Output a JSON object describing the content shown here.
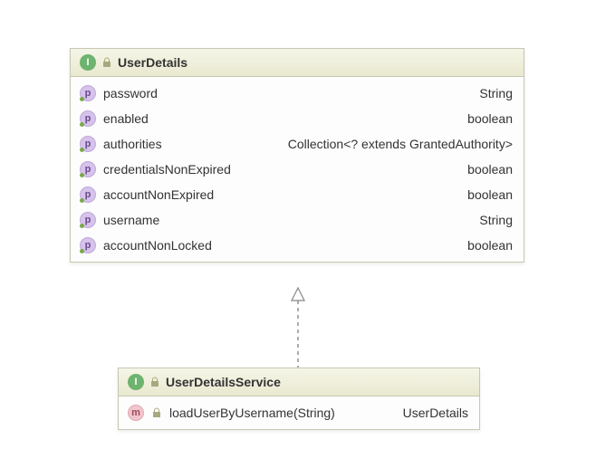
{
  "boxes": [
    {
      "id": "box1",
      "header": {
        "icon": "I",
        "title": "UserDetails"
      },
      "members": [
        {
          "icon": "p",
          "name": "password",
          "type": "String"
        },
        {
          "icon": "p",
          "name": "enabled",
          "type": "boolean"
        },
        {
          "icon": "p",
          "name": "authorities",
          "type": "Collection<? extends GrantedAuthority>"
        },
        {
          "icon": "p",
          "name": "credentialsNonExpired",
          "type": "boolean"
        },
        {
          "icon": "p",
          "name": "accountNonExpired",
          "type": "boolean"
        },
        {
          "icon": "p",
          "name": "username",
          "type": "String"
        },
        {
          "icon": "p",
          "name": "accountNonLocked",
          "type": "boolean"
        }
      ]
    },
    {
      "id": "box2",
      "header": {
        "icon": "I",
        "title": "UserDetailsService"
      },
      "members": [
        {
          "icon": "m",
          "name": "loadUserByUsername(String)",
          "type": "UserDetails"
        }
      ]
    }
  ]
}
